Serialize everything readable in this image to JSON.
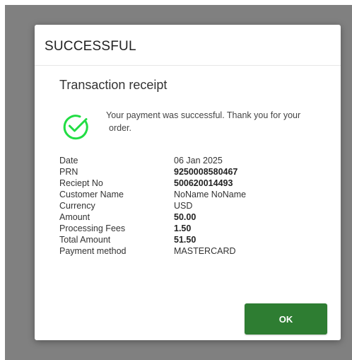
{
  "dialog": {
    "title": "SUCCESSFUL",
    "receipt_title": "Transaction receipt",
    "success_message": "Your payment was successful. Thank you for your order.",
    "success_icon": "check-circle-icon",
    "accent_color": "#2e7d32",
    "icon_color": "#22dd44"
  },
  "details": [
    {
      "label": "Date",
      "value": "06 Jan 2025",
      "bold": false
    },
    {
      "label": "PRN",
      "value": "9250008580467",
      "bold": true
    },
    {
      "label": "Reciept No",
      "value": "500620014493",
      "bold": true
    },
    {
      "label": "Customer Name",
      "value": "NoName NoName",
      "bold": false
    },
    {
      "label": "Currency",
      "value": "USD",
      "bold": false
    },
    {
      "label": "Amount",
      "value": "50.00",
      "bold": true
    },
    {
      "label": "Processing Fees",
      "value": "1.50",
      "bold": true
    },
    {
      "label": "Total Amount",
      "value": "51.50",
      "bold": true
    },
    {
      "label": "Payment method",
      "value": "MASTERCARD",
      "bold": false
    }
  ],
  "actions": {
    "ok_label": "OK"
  }
}
